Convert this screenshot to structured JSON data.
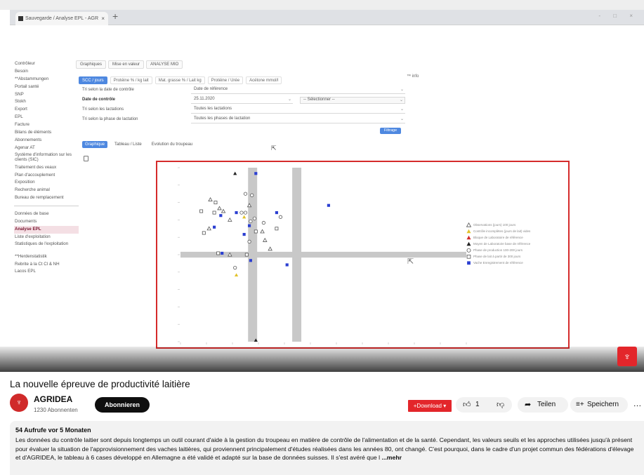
{
  "browser": {
    "tab_title": "Sauvegarde / Analyse EPL - AGR",
    "tab_close": "×",
    "new_tab": "+",
    "window_controls": "- □ ×"
  },
  "app": {
    "sidebar": [
      {
        "label": "Contrôleur",
        "type": "item"
      },
      {
        "label": "Besoin",
        "type": "item"
      },
      {
        "label": "**Abstammungen",
        "type": "item"
      },
      {
        "label": "Portail santé",
        "type": "item"
      },
      {
        "label": "SNP",
        "type": "item"
      },
      {
        "label": "Stokh",
        "type": "item"
      },
      {
        "label": "Export",
        "type": "item"
      },
      {
        "label": "EPL",
        "type": "item"
      },
      {
        "label": "Facture",
        "type": "item"
      },
      {
        "label": "Bilans de éléments",
        "type": "item"
      },
      {
        "label": "Abonnements",
        "type": "item"
      },
      {
        "label": "Agenar AT",
        "type": "item"
      },
      {
        "label": "Système d'information sur les clients (SIC)",
        "type": "two"
      },
      {
        "label": "Traitement des veaux",
        "type": "item"
      },
      {
        "label": "Plan d'accouplement",
        "type": "item"
      },
      {
        "label": "Exposition",
        "type": "item"
      },
      {
        "label": "Recherche animal",
        "type": "item"
      },
      {
        "label": "Bureau de remplacement",
        "type": "item"
      },
      {
        "label": "",
        "type": "sep"
      },
      {
        "label": "Données de base",
        "type": "item"
      },
      {
        "label": "Documents",
        "type": "item"
      },
      {
        "label": "Analyse EPL",
        "type": "active"
      },
      {
        "label": "Liste d'exploitation",
        "type": "item"
      },
      {
        "label": "Statistiques de l'exploitation",
        "type": "two"
      },
      {
        "label": "**Herdenstatistik",
        "type": "item"
      },
      {
        "label": "Rebrite à la Ct Cl & NH",
        "type": "item"
      },
      {
        "label": "Lacos EPL",
        "type": "item"
      }
    ],
    "top_tabs": [
      "Graphiques",
      "Mise en valeur",
      "ANALYSE MIO"
    ],
    "info_label": "™ info",
    "metric_tabs": [
      {
        "label": "SCC / jours",
        "active": true
      },
      {
        "label": "Protéine % / kg lait",
        "active": false
      },
      {
        "label": "Mat. grasse % / Lait kg",
        "active": false
      },
      {
        "label": "Protéine / Urée",
        "active": false
      },
      {
        "label": "Acétone mmol/l",
        "active": false
      }
    ],
    "filters": {
      "row1_label": "Tri selon la date de contrôle",
      "row1_value": "Date de référence",
      "row2_label": "Date de contrôle",
      "row2_value": "25.11.2020",
      "row2_value2": "-- Sélectionner --",
      "row3_label": "Tri selon les lactations",
      "row3_value": "Toutes les lactations",
      "row4_label": "Tri selon la phase de lactation",
      "row4_value": "Toutes les phases de lactation",
      "chevron": "⌄"
    },
    "filter_button": "Filtrage",
    "view_tabs": [
      {
        "label": "Graphique",
        "active": true
      },
      {
        "label": "Tableau / Liste",
        "active": false
      },
      {
        "label": "Evolution du troupeau",
        "active": false
      }
    ],
    "legend": [
      {
        "label": "Observations (jours) 100 jours",
        "shape": "tri-open",
        "color": "#555555"
      },
      {
        "label": "Contrôle incomplètes (jours de lait) vides",
        "shape": "tri-filled",
        "color": "#e2c22a"
      },
      {
        "label": "Bloque de Laboratoire de référence",
        "shape": "tri-filled",
        "color": "#d22a2a"
      },
      {
        "label": "Moyen de Laboratoire base de référence",
        "shape": "tri-filled",
        "color": "#222222"
      },
      {
        "label": "Phase de production 100-200 jours",
        "shape": "circle-open",
        "color": "#555555"
      },
      {
        "label": "Phase de lait à partir de 300 jours",
        "shape": "square-open",
        "color": "#555555"
      },
      {
        "label": "Vache Enregistrement de référence",
        "shape": "square-filled",
        "color": "#2b3fd1"
      }
    ],
    "cursor": "⇱"
  },
  "video": {
    "title": "La nouvelle épreuve de productivité laitière",
    "channel_name": "AGRIDEA",
    "channel_subs": "1230 Abonnenten",
    "subscribe_label": "Abonnieren",
    "download_label": "+Download ▾",
    "like_count": "1",
    "share_label": "Teilen",
    "save_label": "Speichern",
    "more_label": "…",
    "brand_color": "#e3262b",
    "views_line": "54 Aufrufe  vor 5 Monaten",
    "description": "Les données du contrôle laitier sont depuis longtemps un outil courant d'aide à la gestion du troupeau en matière de contrôle de l'alimentation et de la santé. Cependant, les valeurs seuils et les approches utilisées jusqu'à présent pour évaluer la situation de l'approvisionnement des vaches laitières, qui proviennent principalement d'études réalisées dans les années 80, ont changé. C'est pourquoi, dans le cadre d'un projet commun des fédérations d'élevage et d'AGRIDEA, le tableau à 6 cases développé en Allemagne a été validé et adapté sur la base de données suisses. Il s'est avéré que l",
    "more_link": "...mehr"
  },
  "chart_data": {
    "type": "scatter",
    "xlim": [
      0,
      22
    ],
    "ylim": [
      0,
      12
    ],
    "shaded_vertical_bands": [
      [
        5.2,
        5.9
      ],
      [
        8.6,
        9.3
      ]
    ],
    "shaded_horizontal_band": [
      5.8,
      6.2
    ],
    "points": [
      {
        "x": 4.2,
        "y": 11.6,
        "shape": "tri-filled",
        "color": "#222222"
      },
      {
        "x": 5.8,
        "y": 11.6,
        "shape": "square-filled",
        "color": "#2b3fd1"
      },
      {
        "x": 5.0,
        "y": 10.2,
        "shape": "circle-open",
        "color": "#555555"
      },
      {
        "x": 5.5,
        "y": 10.1,
        "shape": "circle-open",
        "color": "#555555"
      },
      {
        "x": 2.3,
        "y": 9.8,
        "shape": "tri-open",
        "color": "#555555"
      },
      {
        "x": 2.7,
        "y": 9.6,
        "shape": "square-open",
        "color": "#555555"
      },
      {
        "x": 5.3,
        "y": 9.4,
        "shape": "tri-open",
        "color": "#555555"
      },
      {
        "x": 3.0,
        "y": 9.2,
        "shape": "tri-open",
        "color": "#555555"
      },
      {
        "x": 3.3,
        "y": 9.0,
        "shape": "tri-open",
        "color": "#555555"
      },
      {
        "x": 1.6,
        "y": 9.0,
        "shape": "square-open",
        "color": "#555555"
      },
      {
        "x": 2.6,
        "y": 8.9,
        "shape": "square-open",
        "color": "#555555"
      },
      {
        "x": 3.1,
        "y": 8.7,
        "shape": "square-filled",
        "color": "#2b3fd1"
      },
      {
        "x": 4.3,
        "y": 8.9,
        "shape": "square-filled",
        "color": "#2b3fd1"
      },
      {
        "x": 4.7,
        "y": 8.9,
        "shape": "circle-open",
        "color": "#555555"
      },
      {
        "x": 5.0,
        "y": 8.9,
        "shape": "circle-open",
        "color": "#555555"
      },
      {
        "x": 4.9,
        "y": 8.6,
        "shape": "tri-filled",
        "color": "#e2c22a"
      },
      {
        "x": 3.8,
        "y": 8.4,
        "shape": "tri-open",
        "color": "#555555"
      },
      {
        "x": 5.4,
        "y": 8.3,
        "shape": "circle-open",
        "color": "#555555"
      },
      {
        "x": 5.7,
        "y": 8.5,
        "shape": "circle-open",
        "color": "#555555"
      },
      {
        "x": 5.3,
        "y": 8.0,
        "shape": "square-filled",
        "color": "#2b3fd1"
      },
      {
        "x": 6.4,
        "y": 8.2,
        "shape": "circle-open",
        "color": "#555555"
      },
      {
        "x": 7.7,
        "y": 8.6,
        "shape": "circle-open",
        "color": "#555555"
      },
      {
        "x": 7.4,
        "y": 8.9,
        "shape": "square-filled",
        "color": "#2b3fd1"
      },
      {
        "x": 11.4,
        "y": 9.4,
        "shape": "square-filled",
        "color": "#2b3fd1"
      },
      {
        "x": 2.2,
        "y": 7.8,
        "shape": "tri-open",
        "color": "#555555"
      },
      {
        "x": 2.6,
        "y": 7.9,
        "shape": "square-filled",
        "color": "#2b3fd1"
      },
      {
        "x": 1.8,
        "y": 7.5,
        "shape": "square-open",
        "color": "#555555"
      },
      {
        "x": 4.9,
        "y": 7.4,
        "shape": "square-filled",
        "color": "#2b3fd1"
      },
      {
        "x": 5.8,
        "y": 7.6,
        "shape": "square-open",
        "color": "#555555"
      },
      {
        "x": 6.3,
        "y": 7.6,
        "shape": "tri-open",
        "color": "#555555"
      },
      {
        "x": 7.4,
        "y": 7.8,
        "shape": "square-open",
        "color": "#555555"
      },
      {
        "x": 6.5,
        "y": 7.0,
        "shape": "tri-open",
        "color": "#555555"
      },
      {
        "x": 5.3,
        "y": 6.9,
        "shape": "circle-open",
        "color": "#555555"
      },
      {
        "x": 6.9,
        "y": 6.4,
        "shape": "tri-open",
        "color": "#555555"
      },
      {
        "x": 2.9,
        "y": 6.1,
        "shape": "square-open",
        "color": "#555555"
      },
      {
        "x": 3.2,
        "y": 6.1,
        "shape": "square-filled",
        "color": "#2b3fd1"
      },
      {
        "x": 3.8,
        "y": 6.0,
        "shape": "tri-open",
        "color": "#555555"
      },
      {
        "x": 5.1,
        "y": 6.0,
        "shape": "square-open",
        "color": "#555555"
      },
      {
        "x": 4.2,
        "y": 5.1,
        "shape": "circle-open",
        "color": "#555555"
      },
      {
        "x": 4.3,
        "y": 4.6,
        "shape": "tri-filled",
        "color": "#e2c22a"
      },
      {
        "x": 5.4,
        "y": 5.6,
        "shape": "square-filled",
        "color": "#2b3fd1"
      },
      {
        "x": 8.2,
        "y": 5.3,
        "shape": "square-filled",
        "color": "#2b3fd1"
      },
      {
        "x": 5.8,
        "y": 0.1,
        "shape": "tri-filled",
        "color": "#222222"
      }
    ]
  }
}
